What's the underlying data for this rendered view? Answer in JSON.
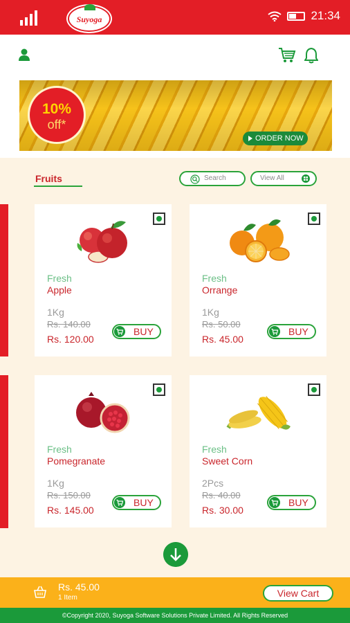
{
  "status_bar": {
    "time": "21:34",
    "battery_level": 0.45
  },
  "logo": {
    "text": "Suyoga"
  },
  "banner": {
    "discount_pct": "10%",
    "discount_off": "off*",
    "order_label": "ORDER NOW"
  },
  "section": {
    "title": "Fruits",
    "search_placeholder": "Search",
    "view_all_label": "View All"
  },
  "products": [
    {
      "fresh": "Fresh",
      "name": "Apple",
      "qty": "1Kg",
      "mrp": "Rs. 140.00",
      "price": "Rs. 120.00",
      "buy": "BUY",
      "image": "apple-image"
    },
    {
      "fresh": "Fresh",
      "name": "Orrange",
      "qty": "1Kg",
      "mrp": "Rs. 50.00",
      "price": "Rs. 45.00",
      "buy": "BUY",
      "image": "orange-image"
    },
    {
      "fresh": "Fresh",
      "name": "Pomegranate",
      "qty": "1Kg",
      "mrp": "Rs. 150.00",
      "price": "Rs. 145.00",
      "buy": "BUY",
      "image": "pomegranate-image"
    },
    {
      "fresh": "Fresh",
      "name": "Sweet Corn",
      "qty": "2Pcs",
      "mrp": "Rs. 40.00",
      "price": "Rs. 30.00",
      "buy": "BUY",
      "image": "sweet-corn-image"
    }
  ],
  "cart": {
    "total": "Rs. 45.00",
    "items": "1 Item",
    "view_cart_label": "View Cart"
  },
  "footer": {
    "copyright": "©Copyright 2020, Suyoga Software Solutions Private Limited. All Rights Reserved"
  },
  "colors": {
    "brand_red": "#e31e26",
    "brand_green": "#1b9a3a",
    "cart_bar": "#fbb11a",
    "background": "#fdf3e3"
  }
}
